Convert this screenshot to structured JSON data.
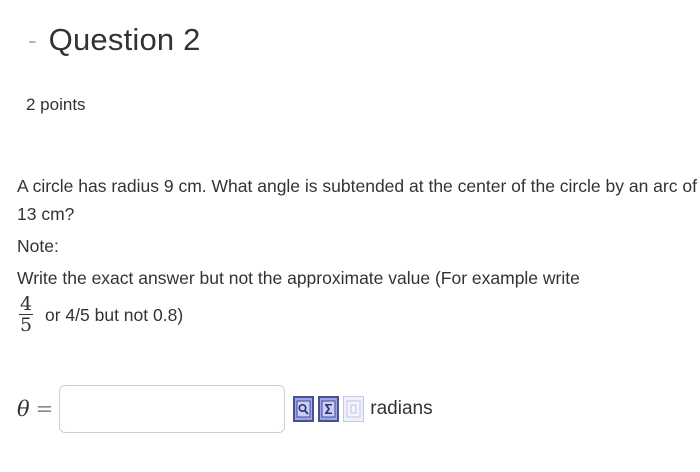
{
  "header": {
    "toggle_symbol": "-",
    "title": "Question 2"
  },
  "points": "2 points",
  "question": {
    "text": "A circle has radius 9 cm. What angle is subtended at the center of the circle by an arc of 13 cm?",
    "note_label": "Note:",
    "instruction": "Write the exact answer but not the approximate value (For example write",
    "example_fraction": {
      "numerator": "4",
      "denominator": "5"
    },
    "example_tail": "or 4/5 but not 0.8)"
  },
  "answer": {
    "variable": "θ",
    "equals": "=",
    "value": "",
    "placeholder": "",
    "units": "radians",
    "tools": [
      {
        "name": "preview-icon"
      },
      {
        "name": "equation-editor-icon"
      },
      {
        "name": "help-icon"
      }
    ]
  },
  "colors": {
    "text": "#333333",
    "toggle": "#b5b5b5",
    "tool_fill": "#9aa6f2",
    "tool_border": "#4b4f8a",
    "input_border": "#cfcfcf"
  }
}
